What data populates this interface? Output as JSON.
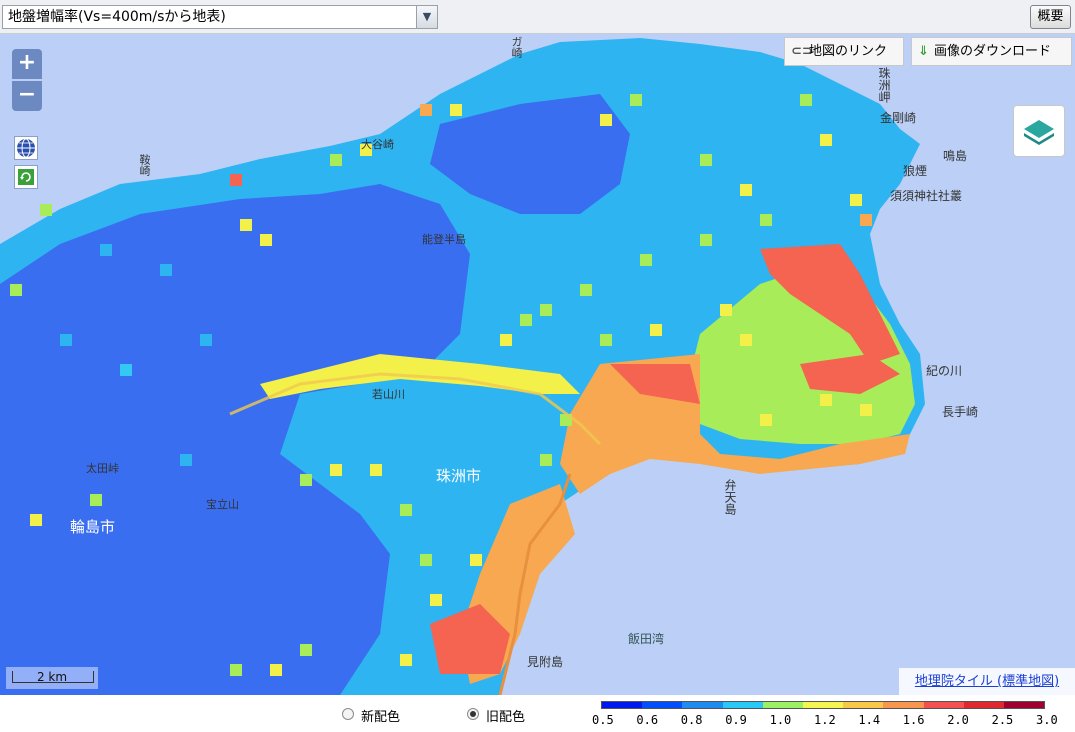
{
  "toolbar": {
    "layer_select_value": "地盤増幅率(Vs=400m/sから地表)",
    "overview_label": "概要"
  },
  "map": {
    "zoom_in": "+",
    "zoom_out": "−",
    "link_label": "地図のリンク",
    "download_label": "画像のダウンロード",
    "scale_label": "2 km",
    "credit": "地理院タイル (標準地図)",
    "places": {
      "wajima": "輪島市",
      "suzu": "珠洲市",
      "wakayama_river": "若山川",
      "noto_peninsula": "能登半島",
      "iida_bay": "飯田湾",
      "mitsukejima": "見附島",
      "nagatezaki": "長手崎",
      "kinokawa": "紀の川",
      "suzu_misaki_shrine": "須須神社社叢",
      "kongozaki": "金剛崎",
      "tatsugakitsuji": "狼煙",
      "benten": "弁天島",
      "hoju": "宝立山",
      "tainose": "太田峠",
      "kuragari": "鞍崎",
      "oyamazaki": "大谷崎",
      "suzumisaki": "珠洲岬",
      "ganmon": "ガ崎",
      "meshima": "鳴島"
    }
  },
  "footer": {
    "new_palette_label": "新配色",
    "old_palette_label": "旧配色",
    "selected": "old"
  },
  "legend": {
    "colors": [
      "#0018f0",
      "#0050ff",
      "#1e8cf0",
      "#28c8f8",
      "#9cf064",
      "#f5f550",
      "#f8c846",
      "#f89650",
      "#f55050",
      "#e02830",
      "#a00030"
    ],
    "ticks": [
      "0.5",
      "0.6",
      "0.8",
      "0.9",
      "1.0",
      "1.2",
      "1.4",
      "1.6",
      "2.0",
      "2.5",
      "3.0"
    ]
  },
  "heatmap_palette": {
    "blue": "#3a6ef0",
    "light_blue": "#2eb4f0",
    "cyan": "#34c8f4",
    "green": "#a8ec5a",
    "yellow": "#f4f04a",
    "orange": "#f8a850",
    "red": "#f46450",
    "sea": "#bcd0f7"
  }
}
